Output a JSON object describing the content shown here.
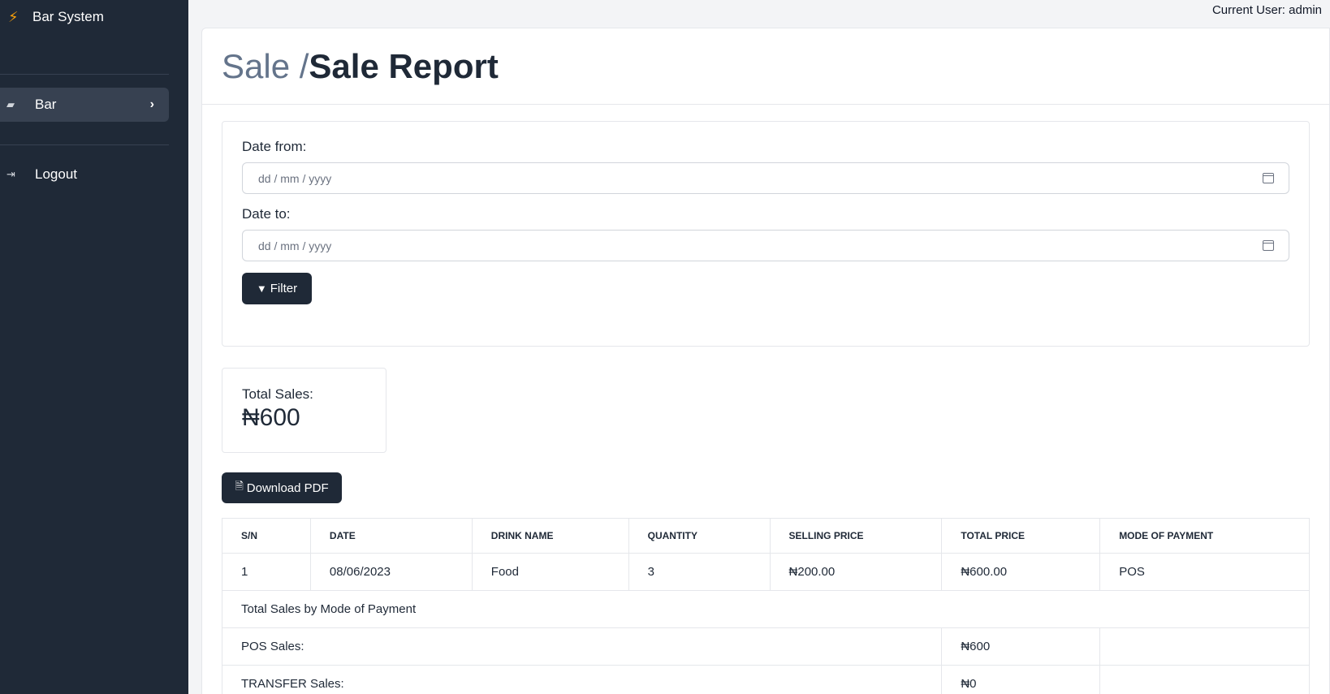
{
  "sidebar": {
    "brand": "Bar System",
    "items": [
      {
        "label": "Bar"
      },
      {
        "label": "Logout"
      }
    ]
  },
  "header": {
    "current_user": "Current User: admin"
  },
  "page": {
    "breadcrumb": "Sale /",
    "title": "Sale Report"
  },
  "filter": {
    "date_from_label": "Date from:",
    "date_from_placeholder": "dd / mm / yyyy",
    "date_to_label": "Date to:",
    "date_to_placeholder": "dd / mm / yyyy",
    "filter_button": "Filter"
  },
  "summary": {
    "label": "Total Sales:",
    "value": "₦600"
  },
  "download_button": "Download PDF",
  "table": {
    "headers": [
      "S/N",
      "DATE",
      "DRINK NAME",
      "QUANTITY",
      "SELLING PRICE",
      "TOTAL PRICE",
      "MODE OF PAYMENT"
    ],
    "rows": [
      [
        "1",
        "08/06/2023",
        "Food",
        "3",
        "₦200.00",
        "₦600.00",
        "POS"
      ]
    ],
    "by_mode_title": "Total Sales by Mode of Payment",
    "mode_rows": [
      {
        "label": "POS Sales:",
        "value": "₦600"
      },
      {
        "label": "TRANSFER Sales:",
        "value": "₦0"
      }
    ]
  }
}
